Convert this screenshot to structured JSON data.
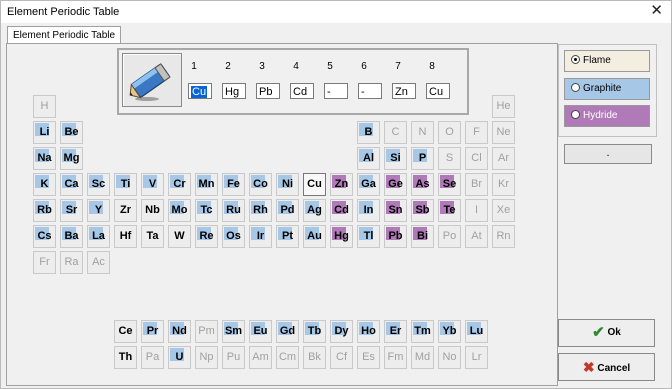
{
  "window": {
    "title": "Element Periodic Table",
    "close": "✕"
  },
  "tab_label": "Element Periodic Table",
  "tool_icon": "pencil-eraser-icon",
  "sample_numbers": [
    "1",
    "2",
    "3",
    "4",
    "5",
    "6",
    "7",
    "8"
  ],
  "samples": [
    "Cu",
    "Hg",
    "Pb",
    "Cd",
    "-",
    "-",
    "Zn",
    "Cu"
  ],
  "selected_sample": 0,
  "colors": {
    "blue": "#a7c7e7",
    "purple": "#b07ab8",
    "flame_bg": "#f3eee0",
    "graphite_bg": "#a7c7e7",
    "hydride_bg": "#b07ab8"
  },
  "modes": [
    {
      "label": "Flame",
      "selected": true
    },
    {
      "label": "Graphite",
      "selected": false
    },
    {
      "label": "Hydride",
      "selected": false
    }
  ],
  "dot_button": ".",
  "ok_label": "Ok",
  "cancel_label": "Cancel",
  "elements": [
    {
      "s": "H",
      "r": 0,
      "c": 0,
      "a": false,
      "h": ""
    },
    {
      "s": "He",
      "r": 0,
      "c": 17,
      "a": false,
      "h": ""
    },
    {
      "s": "Li",
      "r": 1,
      "c": 0,
      "a": true,
      "h": "blue"
    },
    {
      "s": "Be",
      "r": 1,
      "c": 1,
      "a": true,
      "h": "blue"
    },
    {
      "s": "B",
      "r": 1,
      "c": 12,
      "a": true,
      "h": "blue"
    },
    {
      "s": "C",
      "r": 1,
      "c": 13,
      "a": false,
      "h": ""
    },
    {
      "s": "N",
      "r": 1,
      "c": 14,
      "a": false,
      "h": ""
    },
    {
      "s": "O",
      "r": 1,
      "c": 15,
      "a": false,
      "h": ""
    },
    {
      "s": "F",
      "r": 1,
      "c": 16,
      "a": false,
      "h": ""
    },
    {
      "s": "Ne",
      "r": 1,
      "c": 17,
      "a": false,
      "h": ""
    },
    {
      "s": "Na",
      "r": 2,
      "c": 0,
      "a": true,
      "h": "blue"
    },
    {
      "s": "Mg",
      "r": 2,
      "c": 1,
      "a": true,
      "h": "blue"
    },
    {
      "s": "Al",
      "r": 2,
      "c": 12,
      "a": true,
      "h": "blue"
    },
    {
      "s": "Si",
      "r": 2,
      "c": 13,
      "a": true,
      "h": "blue"
    },
    {
      "s": "P",
      "r": 2,
      "c": 14,
      "a": true,
      "h": "blue"
    },
    {
      "s": "S",
      "r": 2,
      "c": 15,
      "a": false,
      "h": ""
    },
    {
      "s": "Cl",
      "r": 2,
      "c": 16,
      "a": false,
      "h": ""
    },
    {
      "s": "Ar",
      "r": 2,
      "c": 17,
      "a": false,
      "h": ""
    },
    {
      "s": "K",
      "r": 3,
      "c": 0,
      "a": true,
      "h": "blue"
    },
    {
      "s": "Ca",
      "r": 3,
      "c": 1,
      "a": true,
      "h": "blue"
    },
    {
      "s": "Sc",
      "r": 3,
      "c": 2,
      "a": true,
      "h": "blue"
    },
    {
      "s": "Ti",
      "r": 3,
      "c": 3,
      "a": true,
      "h": "blue"
    },
    {
      "s": "V",
      "r": 3,
      "c": 4,
      "a": true,
      "h": "blue"
    },
    {
      "s": "Cr",
      "r": 3,
      "c": 5,
      "a": true,
      "h": "blue"
    },
    {
      "s": "Mn",
      "r": 3,
      "c": 6,
      "a": true,
      "h": "blue"
    },
    {
      "s": "Fe",
      "r": 3,
      "c": 7,
      "a": true,
      "h": "blue"
    },
    {
      "s": "Co",
      "r": 3,
      "c": 8,
      "a": true,
      "h": "blue"
    },
    {
      "s": "Ni",
      "r": 3,
      "c": 9,
      "a": true,
      "h": "blue"
    },
    {
      "s": "Cu",
      "r": 3,
      "c": 10,
      "a": true,
      "h": "",
      "f": true
    },
    {
      "s": "Zn",
      "r": 3,
      "c": 11,
      "a": true,
      "h": "purple"
    },
    {
      "s": "Ga",
      "r": 3,
      "c": 12,
      "a": true,
      "h": "blue"
    },
    {
      "s": "Ge",
      "r": 3,
      "c": 13,
      "a": true,
      "h": "purple"
    },
    {
      "s": "As",
      "r": 3,
      "c": 14,
      "a": true,
      "h": "purple"
    },
    {
      "s": "Se",
      "r": 3,
      "c": 15,
      "a": true,
      "h": "purple"
    },
    {
      "s": "Br",
      "r": 3,
      "c": 16,
      "a": false,
      "h": ""
    },
    {
      "s": "Kr",
      "r": 3,
      "c": 17,
      "a": false,
      "h": ""
    },
    {
      "s": "Rb",
      "r": 4,
      "c": 0,
      "a": true,
      "h": "blue"
    },
    {
      "s": "Sr",
      "r": 4,
      "c": 1,
      "a": true,
      "h": "blue"
    },
    {
      "s": "Y",
      "r": 4,
      "c": 2,
      "a": true,
      "h": "blue"
    },
    {
      "s": "Zr",
      "r": 4,
      "c": 3,
      "a": true,
      "h": ""
    },
    {
      "s": "Nb",
      "r": 4,
      "c": 4,
      "a": true,
      "h": ""
    },
    {
      "s": "Mo",
      "r": 4,
      "c": 5,
      "a": true,
      "h": "blue"
    },
    {
      "s": "Tc",
      "r": 4,
      "c": 6,
      "a": true,
      "h": "blue"
    },
    {
      "s": "Ru",
      "r": 4,
      "c": 7,
      "a": true,
      "h": "blue"
    },
    {
      "s": "Rh",
      "r": 4,
      "c": 8,
      "a": true,
      "h": "blue"
    },
    {
      "s": "Pd",
      "r": 4,
      "c": 9,
      "a": true,
      "h": "blue"
    },
    {
      "s": "Ag",
      "r": 4,
      "c": 10,
      "a": true,
      "h": "blue"
    },
    {
      "s": "Cd",
      "r": 4,
      "c": 11,
      "a": true,
      "h": "purple"
    },
    {
      "s": "In",
      "r": 4,
      "c": 12,
      "a": true,
      "h": "blue"
    },
    {
      "s": "Sn",
      "r": 4,
      "c": 13,
      "a": true,
      "h": "purple"
    },
    {
      "s": "Sb",
      "r": 4,
      "c": 14,
      "a": true,
      "h": "purple"
    },
    {
      "s": "Te",
      "r": 4,
      "c": 15,
      "a": true,
      "h": "purple"
    },
    {
      "s": "I",
      "r": 4,
      "c": 16,
      "a": false,
      "h": ""
    },
    {
      "s": "Xe",
      "r": 4,
      "c": 17,
      "a": false,
      "h": ""
    },
    {
      "s": "Cs",
      "r": 5,
      "c": 0,
      "a": true,
      "h": "blue"
    },
    {
      "s": "Ba",
      "r": 5,
      "c": 1,
      "a": true,
      "h": "blue"
    },
    {
      "s": "La",
      "r": 5,
      "c": 2,
      "a": true,
      "h": "blue"
    },
    {
      "s": "Hf",
      "r": 5,
      "c": 3,
      "a": true,
      "h": ""
    },
    {
      "s": "Ta",
      "r": 5,
      "c": 4,
      "a": true,
      "h": ""
    },
    {
      "s": "W",
      "r": 5,
      "c": 5,
      "a": true,
      "h": ""
    },
    {
      "s": "Re",
      "r": 5,
      "c": 6,
      "a": true,
      "h": "blue"
    },
    {
      "s": "Os",
      "r": 5,
      "c": 7,
      "a": true,
      "h": "blue"
    },
    {
      "s": "Ir",
      "r": 5,
      "c": 8,
      "a": true,
      "h": "blue"
    },
    {
      "s": "Pt",
      "r": 5,
      "c": 9,
      "a": true,
      "h": "blue"
    },
    {
      "s": "Au",
      "r": 5,
      "c": 10,
      "a": true,
      "h": "blue"
    },
    {
      "s": "Hg",
      "r": 5,
      "c": 11,
      "a": true,
      "h": "purple"
    },
    {
      "s": "Tl",
      "r": 5,
      "c": 12,
      "a": true,
      "h": "blue"
    },
    {
      "s": "Pb",
      "r": 5,
      "c": 13,
      "a": true,
      "h": "purple"
    },
    {
      "s": "Bi",
      "r": 5,
      "c": 14,
      "a": true,
      "h": "purple"
    },
    {
      "s": "Po",
      "r": 5,
      "c": 15,
      "a": false,
      "h": ""
    },
    {
      "s": "At",
      "r": 5,
      "c": 16,
      "a": false,
      "h": ""
    },
    {
      "s": "Rn",
      "r": 5,
      "c": 17,
      "a": false,
      "h": ""
    },
    {
      "s": "Fr",
      "r": 6,
      "c": 0,
      "a": false,
      "h": ""
    },
    {
      "s": "Ra",
      "r": 6,
      "c": 1,
      "a": false,
      "h": ""
    },
    {
      "s": "Ac",
      "r": 6,
      "c": 2,
      "a": false,
      "h": ""
    },
    {
      "s": "Ce",
      "r": 7,
      "c": 3,
      "a": true,
      "h": ""
    },
    {
      "s": "Pr",
      "r": 7,
      "c": 4,
      "a": true,
      "h": "blue"
    },
    {
      "s": "Nd",
      "r": 7,
      "c": 5,
      "a": true,
      "h": "blue"
    },
    {
      "s": "Pm",
      "r": 7,
      "c": 6,
      "a": false,
      "h": ""
    },
    {
      "s": "Sm",
      "r": 7,
      "c": 7,
      "a": true,
      "h": "blue"
    },
    {
      "s": "Eu",
      "r": 7,
      "c": 8,
      "a": true,
      "h": "blue"
    },
    {
      "s": "Gd",
      "r": 7,
      "c": 9,
      "a": true,
      "h": "blue"
    },
    {
      "s": "Tb",
      "r": 7,
      "c": 10,
      "a": true,
      "h": "blue"
    },
    {
      "s": "Dy",
      "r": 7,
      "c": 11,
      "a": true,
      "h": "blue"
    },
    {
      "s": "Ho",
      "r": 7,
      "c": 12,
      "a": true,
      "h": "blue"
    },
    {
      "s": "Er",
      "r": 7,
      "c": 13,
      "a": true,
      "h": "blue"
    },
    {
      "s": "Tm",
      "r": 7,
      "c": 14,
      "a": true,
      "h": "blue"
    },
    {
      "s": "Yb",
      "r": 7,
      "c": 15,
      "a": true,
      "h": "blue"
    },
    {
      "s": "Lu",
      "r": 7,
      "c": 16,
      "a": true,
      "h": "blue"
    },
    {
      "s": "Th",
      "r": 8,
      "c": 3,
      "a": true,
      "h": ""
    },
    {
      "s": "Pa",
      "r": 8,
      "c": 4,
      "a": false,
      "h": ""
    },
    {
      "s": "U",
      "r": 8,
      "c": 5,
      "a": true,
      "h": "blue"
    },
    {
      "s": "Np",
      "r": 8,
      "c": 6,
      "a": false,
      "h": ""
    },
    {
      "s": "Pu",
      "r": 8,
      "c": 7,
      "a": false,
      "h": ""
    },
    {
      "s": "Am",
      "r": 8,
      "c": 8,
      "a": false,
      "h": ""
    },
    {
      "s": "Cm",
      "r": 8,
      "c": 9,
      "a": false,
      "h": ""
    },
    {
      "s": "Bk",
      "r": 8,
      "c": 10,
      "a": false,
      "h": ""
    },
    {
      "s": "Cf",
      "r": 8,
      "c": 11,
      "a": false,
      "h": ""
    },
    {
      "s": "Es",
      "r": 8,
      "c": 12,
      "a": false,
      "h": ""
    },
    {
      "s": "Fm",
      "r": 8,
      "c": 13,
      "a": false,
      "h": ""
    },
    {
      "s": "Md",
      "r": 8,
      "c": 14,
      "a": false,
      "h": ""
    },
    {
      "s": "No",
      "r": 8,
      "c": 15,
      "a": false,
      "h": ""
    },
    {
      "s": "Lr",
      "r": 8,
      "c": 16,
      "a": false,
      "h": ""
    }
  ]
}
